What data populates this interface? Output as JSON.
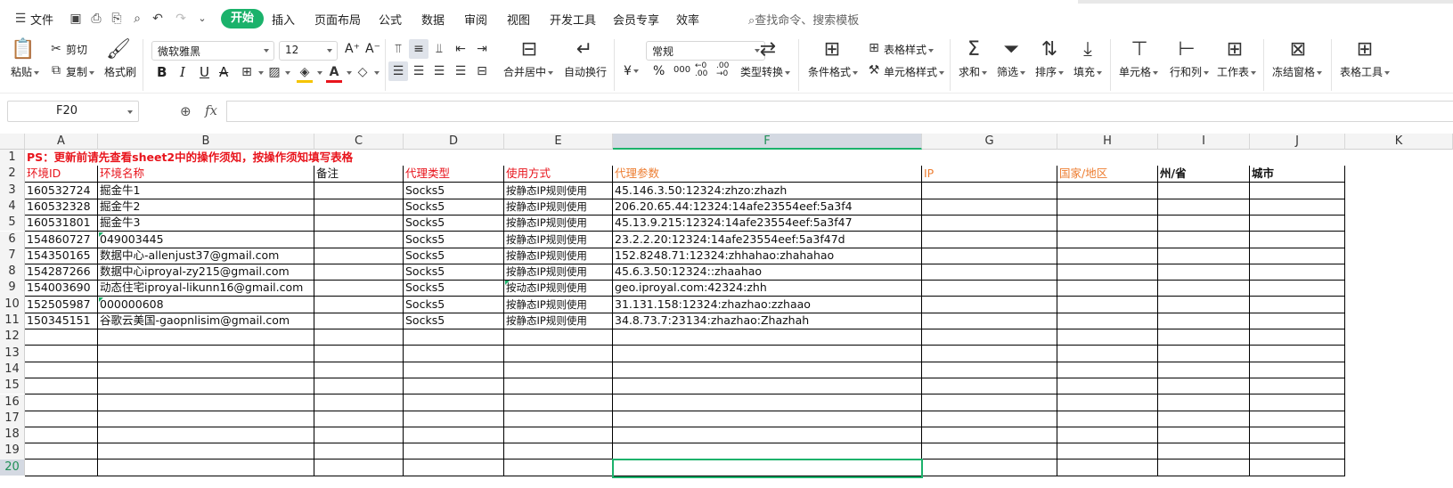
{
  "menubar": {
    "file_label": "文件",
    "tabs": [
      {
        "label": "开始",
        "active": true
      },
      {
        "label": "插入"
      },
      {
        "label": "页面布局"
      },
      {
        "label": "公式"
      },
      {
        "label": "数据"
      },
      {
        "label": "审阅"
      },
      {
        "label": "视图"
      },
      {
        "label": "开发工具"
      },
      {
        "label": "会员专享"
      },
      {
        "label": "效率"
      }
    ],
    "search_placeholder": "查找命令、搜索模板"
  },
  "ribbon": {
    "paste": "粘贴",
    "cut": "剪切",
    "copy": "复制",
    "format_painter": "格式刷",
    "font_name": "微软雅黑",
    "font_size": "12",
    "bold": "B",
    "italic": "I",
    "underline": "U",
    "merge_center": "合并居中",
    "wrap_text": "自动换行",
    "number_format": "常规",
    "currency": "¥",
    "percent": "%",
    "thousands": "000",
    "type_convert": "类型转换",
    "conditional_format": "条件格式",
    "table_style": "表格样式",
    "cell_style": "单元格样式",
    "sum": "求和",
    "filter": "筛选",
    "sort": "排序",
    "fill": "填充",
    "cell": "单元格",
    "row_col": "行和列",
    "worksheet": "工作表",
    "freeze": "冻结窗格",
    "table_tools": "表格工具"
  },
  "formula_bar": {
    "name_box": "F20",
    "fx": "fx",
    "formula": ""
  },
  "sheet": {
    "columns": [
      "A",
      "B",
      "C",
      "D",
      "E",
      "F",
      "G",
      "H",
      "I",
      "J",
      "K"
    ],
    "selected_column": "F",
    "selected_row": "20",
    "rows": [
      "1",
      "2",
      "3",
      "4",
      "5",
      "6",
      "7",
      "8",
      "9",
      "10",
      "11",
      "12",
      "13",
      "14",
      "15",
      "16",
      "17",
      "18",
      "19",
      "20"
    ],
    "notice": "PS：更新前请先查看sheet2中的操作须知，按操作须知填写表格",
    "headers": {
      "A": "环境ID",
      "B": "环境名称",
      "C": "备注",
      "D": "代理类型",
      "E": "使用方式",
      "F": "代理参数",
      "G": "IP",
      "H": "国家/地区",
      "I": "州/省",
      "J": "城市"
    },
    "data": [
      {
        "A": "160532724",
        "B": "掘金牛1",
        "D": "Socks5",
        "E": "按静态IP规则使用",
        "F": "45.146.3.50:12324:zhzo:zhazh"
      },
      {
        "A": "160532328",
        "B": "掘金牛2",
        "D": "Socks5",
        "E": "按静态IP规则使用",
        "F": "206.20.65.44:12324:14afe23554eef:5a3f4"
      },
      {
        "A": "160531801",
        "B": "掘金牛3",
        "D": "Socks5",
        "E": "按静态IP规则使用",
        "F": "45.13.9.215:12324:14afe23554eef:5a3f47"
      },
      {
        "A": "154860727",
        "B": "049003445",
        "D": "Socks5",
        "E": "按静态IP规则使用",
        "F": "23.2.2.20:12324:14afe23554eef:5a3f47d"
      },
      {
        "A": "154350165",
        "B": "数据中心-allenjust37@gmail.com",
        "D": "Socks5",
        "E": "按静态IP规则使用",
        "F": "152.8248.71:12324:zhhahao:zhahahao"
      },
      {
        "A": "154287266",
        "B": "数据中心iproyal-zy215@gmail.com",
        "D": "Socks5",
        "E": "按静态IP规则使用",
        "F": "45.6.3.50:12324::zhaahao"
      },
      {
        "A": "154003690",
        "B": "动态住宅iproyal-likunn16@gmail.com",
        "D": "Socks5",
        "E": "按动态IP规则使用",
        "F": "geo.iproyal.com:42324:zhh"
      },
      {
        "A": "152505987",
        "B": "000000608",
        "D": "Socks5",
        "E": "按静态IP规则使用",
        "F": "31.131.158:12324:zhazhao:zzhaao"
      },
      {
        "A": "150345151",
        "B": "谷歌云美国-gaopnlisim@gmail.com",
        "D": "Socks5",
        "E": "按静态IP规则使用",
        "F": "34.8.73.7:23134:zhazhao:Zhazhah"
      }
    ]
  },
  "colors": {
    "accent_green": "#1bb26b",
    "header_red": "#e8141c",
    "header_orange": "#ed7d31"
  }
}
